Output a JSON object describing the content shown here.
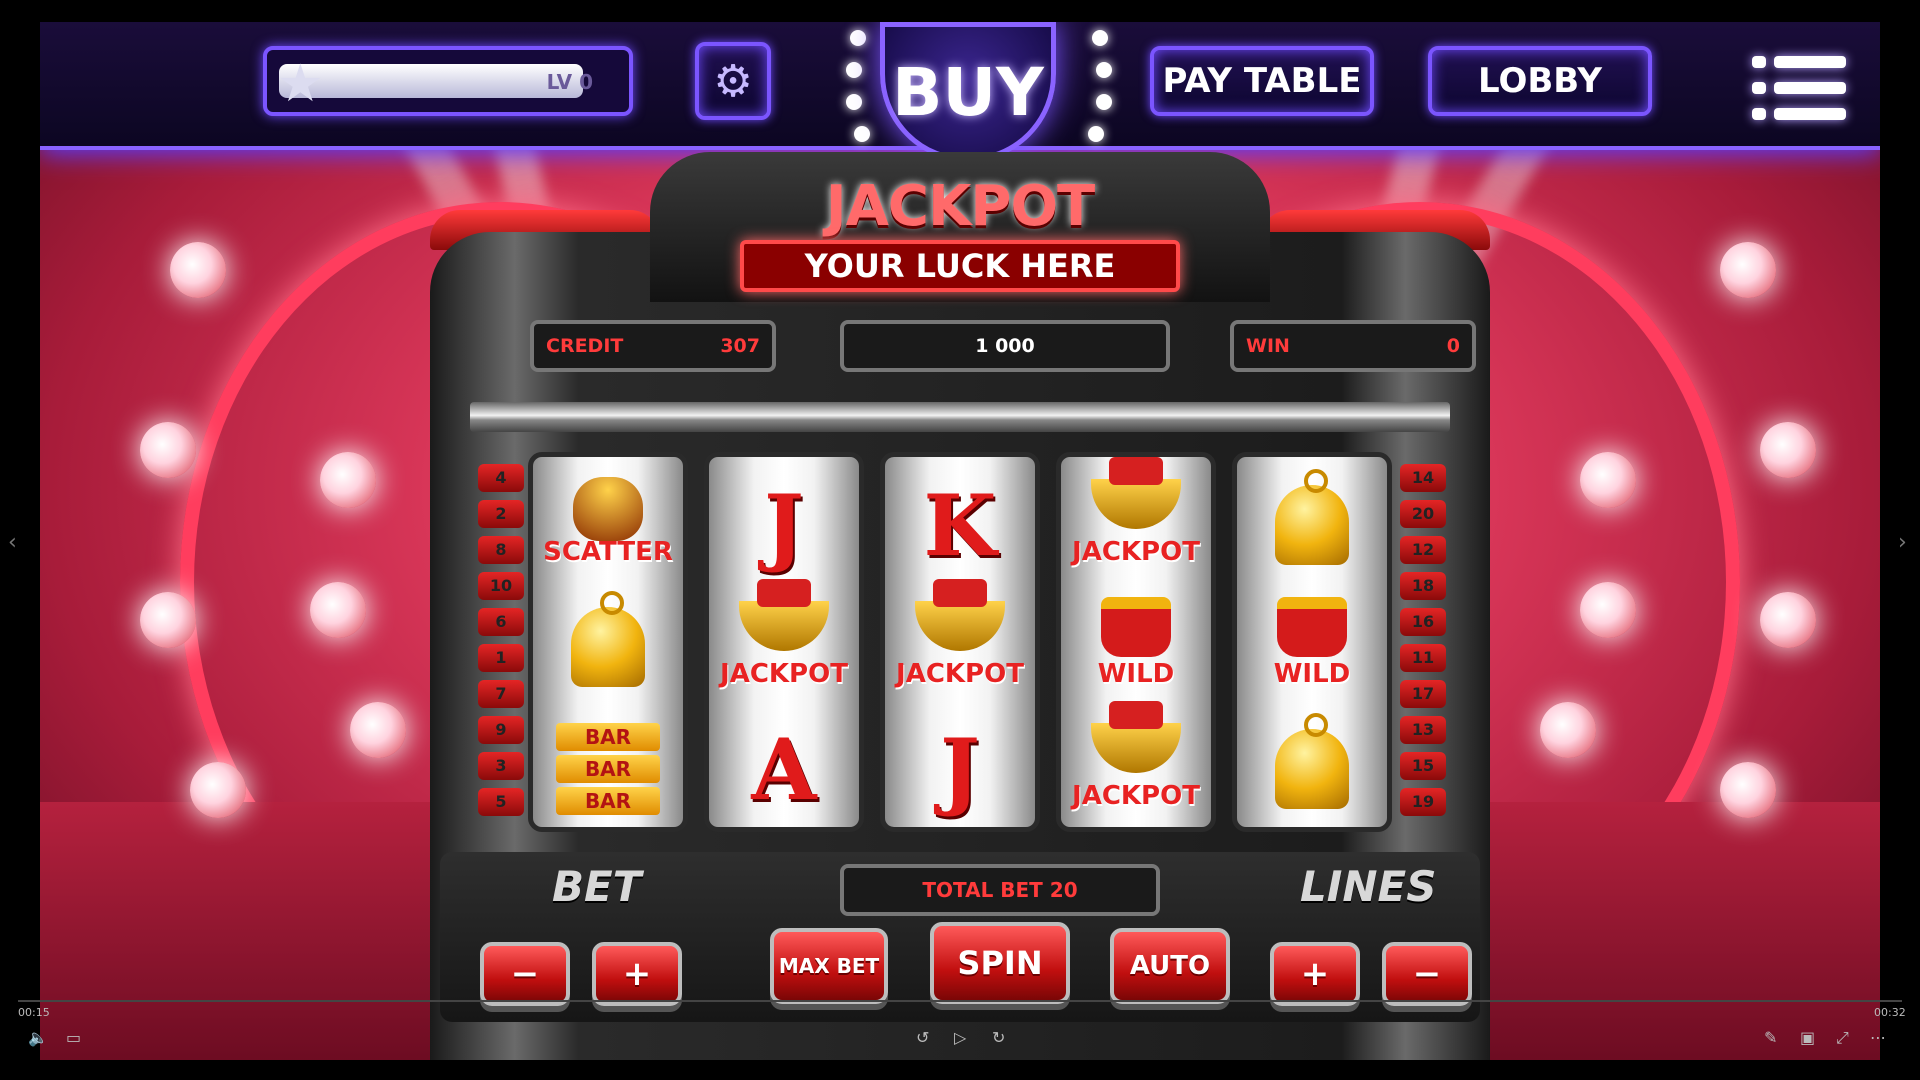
{
  "topbar": {
    "level_label": "LV 0",
    "level_progress": 0.92,
    "buy_label": "BUY",
    "paytable_label": "PAY TABLE",
    "lobby_label": "LOBBY"
  },
  "machine": {
    "jackpot_title": "JACKPOT",
    "luck_label": "YOUR LUCK HERE",
    "credit_label": "CREDIT",
    "credit_value": "307",
    "jackpot_value": "1 000",
    "win_label": "WIN",
    "win_value": "0",
    "left_lines": [
      "4",
      "2",
      "8",
      "10",
      "6",
      "1",
      "7",
      "9",
      "3",
      "5"
    ],
    "right_lines": [
      "14",
      "20",
      "12",
      "18",
      "16",
      "11",
      "17",
      "13",
      "15",
      "19"
    ],
    "reels": [
      [
        {
          "type": "scatter",
          "label": "SCATTER"
        },
        {
          "type": "bell"
        },
        {
          "type": "bar",
          "label": "BAR"
        }
      ],
      [
        {
          "type": "letter",
          "label": "J"
        },
        {
          "type": "jackpot",
          "label": "JACKPOT"
        },
        {
          "type": "letter",
          "label": "A"
        }
      ],
      [
        {
          "type": "letter",
          "label": "K"
        },
        {
          "type": "jackpot",
          "label": "JACKPOT"
        },
        {
          "type": "letter",
          "label": "J"
        }
      ],
      [
        {
          "type": "jackpot",
          "label": "JACKPOT"
        },
        {
          "type": "wild",
          "label": "WILD"
        },
        {
          "type": "jackpot",
          "label": "JACKPOT"
        }
      ],
      [
        {
          "type": "bell"
        },
        {
          "type": "wild",
          "label": "WILD"
        },
        {
          "type": "bell"
        }
      ]
    ],
    "total_bet_label": "TOTAL BET 20",
    "bet_label": "BET",
    "lines_label": "LINES",
    "minus_glyph": "−",
    "plus_glyph": "+",
    "maxbet_label": "MAX BET",
    "spin_label": "SPIN",
    "auto_label": "AUTO"
  },
  "player": {
    "elapsed": "00:15",
    "remaining": "00:32"
  },
  "colors": {
    "accent": "#7b55ff",
    "reel_red": "#e01b1b",
    "gold": "#f1b40f"
  }
}
